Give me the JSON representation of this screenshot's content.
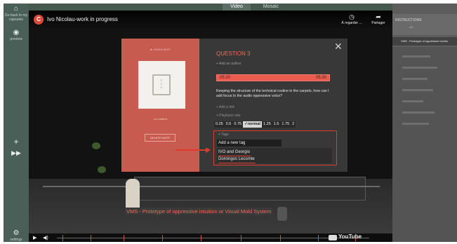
{
  "sidebar": {
    "back_label": "Go back to my capsules",
    "preview_label": "preview",
    "settings_label": "settings"
  },
  "topbar": {
    "tabs": [
      {
        "label": "Video"
      },
      {
        "label": "Mosaic"
      }
    ]
  },
  "video_header": {
    "channel_initial": "C",
    "title": "Ivo Nicolau-work in progress",
    "watch_later": "À regarder ...",
    "share": "Partager"
  },
  "modal": {
    "highlight_label": "★ HIGHLIGHT",
    "no_content": "no content",
    "delete_note": "DELETE NOTE",
    "question_title": "QUESTION 3",
    "add_author": "+ Add an author",
    "time_start": "05:20",
    "time_end": "05:30",
    "description": "Keeping the structure of the technical routine in the carpets, how can I add focus to the audio oppressive voice?",
    "add_link": "+ Add a link",
    "playback_label": "+ Playback rate",
    "playback_options": [
      "0.25",
      "0.5",
      "0.75",
      "✓normal",
      "1.25",
      "1.5",
      "1.75",
      "2"
    ],
    "playback_selected": "✓normal",
    "tags_label": "+ Tags",
    "tag_input_placeholder": "Add a new tag",
    "tags": [
      "IVO and Georgio",
      "Domingos Lecomte"
    ]
  },
  "subtitle": "VMS - Prototype of oppressive intuition or Visual Mold System",
  "player": {
    "youtube_label": "YouTube"
  },
  "right_panel": {
    "title": "INSTRUCTIONS",
    "subtitle": "a/V",
    "item": "VMS - Prototype of oppressive intuitio"
  },
  "colors": {
    "accent": "#ef6b5c",
    "highlight_panel": "#c75b50",
    "annotation_red": "#e23b2e",
    "sidebar": "#4a5f58"
  }
}
